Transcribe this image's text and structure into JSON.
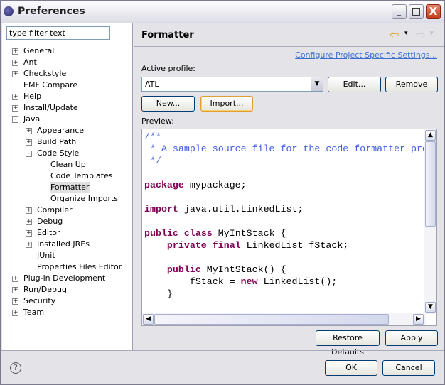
{
  "window": {
    "title": "Preferences",
    "minimize": "_",
    "maximize": "□",
    "close": "X"
  },
  "filter": {
    "placeholder": "type filter text",
    "value": "type filter text"
  },
  "tree": [
    {
      "label": "General",
      "level": 0,
      "toggle": "+"
    },
    {
      "label": "Ant",
      "level": 0,
      "toggle": "+"
    },
    {
      "label": "Checkstyle",
      "level": 0,
      "toggle": "+"
    },
    {
      "label": "EMF Compare",
      "level": 0,
      "toggle": ""
    },
    {
      "label": "Help",
      "level": 0,
      "toggle": "+"
    },
    {
      "label": "Install/Update",
      "level": 0,
      "toggle": "+"
    },
    {
      "label": "Java",
      "level": 0,
      "toggle": "-"
    },
    {
      "label": "Appearance",
      "level": 1,
      "toggle": "+"
    },
    {
      "label": "Build Path",
      "level": 1,
      "toggle": "+"
    },
    {
      "label": "Code Style",
      "level": 1,
      "toggle": "-"
    },
    {
      "label": "Clean Up",
      "level": 2,
      "toggle": ""
    },
    {
      "label": "Code Templates",
      "level": 2,
      "toggle": ""
    },
    {
      "label": "Formatter",
      "level": 2,
      "toggle": "",
      "selected": true
    },
    {
      "label": "Organize Imports",
      "level": 2,
      "toggle": ""
    },
    {
      "label": "Compiler",
      "level": 1,
      "toggle": "+"
    },
    {
      "label": "Debug",
      "level": 1,
      "toggle": "+"
    },
    {
      "label": "Editor",
      "level": 1,
      "toggle": "+"
    },
    {
      "label": "Installed JREs",
      "level": 1,
      "toggle": "+"
    },
    {
      "label": "JUnit",
      "level": 1,
      "toggle": ""
    },
    {
      "label": "Properties Files Editor",
      "level": 1,
      "toggle": ""
    },
    {
      "label": "Plug-in Development",
      "level": 0,
      "toggle": "+"
    },
    {
      "label": "Run/Debug",
      "level": 0,
      "toggle": "+"
    },
    {
      "label": "Security",
      "level": 0,
      "toggle": "+"
    },
    {
      "label": "Team",
      "level": 0,
      "toggle": "+"
    }
  ],
  "page": {
    "title": "Formatter",
    "back_icon": "⇦",
    "forward_icon": "⇨",
    "menu_arrow": "▾",
    "configure_link": "Configure Project Specific Settings...",
    "active_profile_label": "Active profile:",
    "profile_value": "ATL",
    "edit": "Edit...",
    "remove": "Remove",
    "new": "New...",
    "import": "Import...",
    "preview_label": "Preview:",
    "code": [
      [
        {
          "t": "/**",
          "c": "cm"
        }
      ],
      [
        {
          "t": " * A sample source file for the code formatter preview",
          "c": "cm"
        }
      ],
      [
        {
          "t": " */",
          "c": "cm"
        }
      ],
      [],
      [
        {
          "t": "package",
          "c": "kw"
        },
        {
          "t": " mypackage;"
        }
      ],
      [],
      [
        {
          "t": "import",
          "c": "kw"
        },
        {
          "t": " java.util.LinkedList;"
        }
      ],
      [],
      [
        {
          "t": "public",
          "c": "kw"
        },
        {
          "t": " "
        },
        {
          "t": "class",
          "c": "kw"
        },
        {
          "t": " MyIntStack {"
        }
      ],
      [
        {
          "t": "    "
        },
        {
          "t": "private",
          "c": "kw"
        },
        {
          "t": " "
        },
        {
          "t": "final",
          "c": "kw"
        },
        {
          "t": " LinkedList fStack;"
        }
      ],
      [],
      [
        {
          "t": "    "
        },
        {
          "t": "public",
          "c": "kw"
        },
        {
          "t": " MyIntStack() {"
        }
      ],
      [
        {
          "t": "        fStack = "
        },
        {
          "t": "new",
          "c": "kw"
        },
        {
          "t": " LinkedList();"
        }
      ],
      [
        {
          "t": "    }"
        }
      ]
    ],
    "restore_defaults": "Restore Defaults",
    "apply": "Apply"
  },
  "footer": {
    "help_icon": "?",
    "ok": "OK",
    "cancel": "Cancel"
  }
}
